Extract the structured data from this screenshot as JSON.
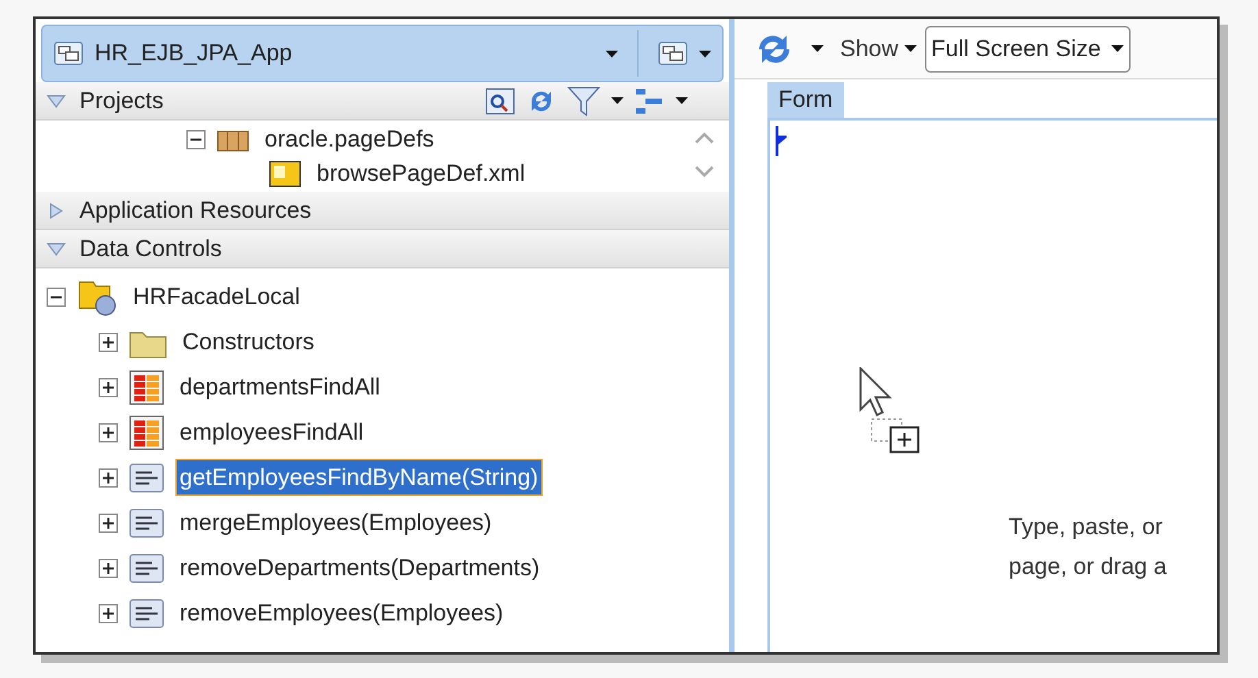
{
  "navigator": {
    "app_selector": "HR_EJB_JPA_App",
    "sections": [
      {
        "title": "Projects",
        "expanded": true,
        "tree": [
          {
            "label": "oracle.pageDefs",
            "kind": "package",
            "expanded": true,
            "selected": false,
            "children": [
              {
                "label": "browsePageDef.xml",
                "kind": "file",
                "selected": false
              }
            ]
          }
        ]
      },
      {
        "title": "Application Resources",
        "expanded": false
      },
      {
        "title": "Data Controls",
        "expanded": true,
        "tree": [
          {
            "label": "HRFacadeLocal",
            "kind": "data_control",
            "expanded": true,
            "selected": false,
            "children": [
              {
                "label": "Constructors",
                "kind": "folder",
                "expanded": false,
                "selected": false
              },
              {
                "label": "departmentsFindAll",
                "kind": "collection",
                "expanded": false,
                "selected": false
              },
              {
                "label": "employeesFindAll",
                "kind": "collection",
                "expanded": false,
                "selected": false
              },
              {
                "label": "getEmployeesFindByName(String)",
                "kind": "method",
                "expanded": false,
                "selected": true
              },
              {
                "label": "mergeEmployees(Employees)",
                "kind": "method",
                "expanded": false,
                "selected": false
              },
              {
                "label": "removeDepartments(Departments)",
                "kind": "method",
                "expanded": false,
                "selected": false
              },
              {
                "label": "removeEmployees(Employees)",
                "kind": "method",
                "expanded": false,
                "selected": false
              }
            ]
          }
        ]
      }
    ]
  },
  "editor": {
    "toolbar": {
      "show_label": "Show",
      "size_value": "Full Screen Size"
    },
    "tab": "Form",
    "hint_lines": [
      "Type, paste, or",
      "page, or drag a"
    ]
  }
}
